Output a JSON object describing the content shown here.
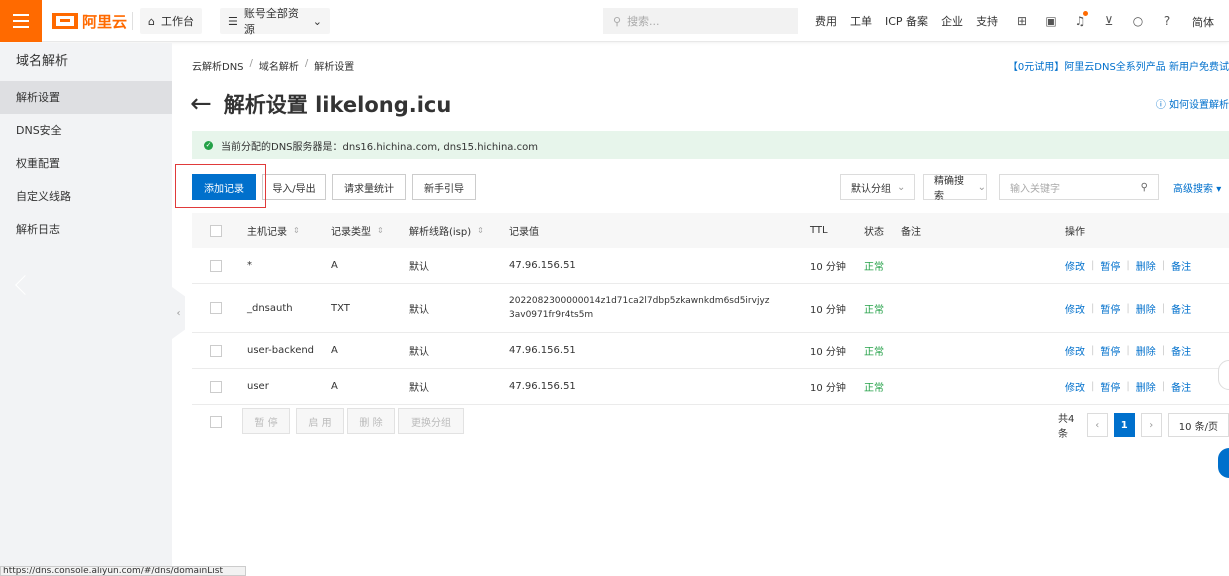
{
  "topbar": {
    "brand": "阿里云",
    "workbench": "工作台",
    "resources": "账号全部资源",
    "search_placeholder": "搜索...",
    "links": [
      "费用",
      "工单",
      "ICP 备案",
      "企业",
      "支持"
    ],
    "lang": "简体"
  },
  "sidebar": {
    "title": "域名解析",
    "items": [
      {
        "label": "解析设置",
        "active": true
      },
      {
        "label": "DNS安全",
        "active": false
      },
      {
        "label": "权重配置",
        "active": false
      },
      {
        "label": "自定义线路",
        "active": false
      },
      {
        "label": "解析日志",
        "active": false
      }
    ]
  },
  "breadcrumb": [
    "云解析DNS",
    "域名解析",
    "解析设置"
  ],
  "promo": "【0元试用】阿里云DNS全系列产品 新用户免费试",
  "page_title": "解析设置 likelong.icu",
  "help_link": "如何设置解析",
  "dns_banner": "当前分配的DNS服务器是：dns16.hichina.com, dns15.hichina.com",
  "toolbar": {
    "add": "添加记录",
    "import_export": "导入/导出",
    "stats": "请求量统计",
    "guide": "新手引导",
    "group_select": "默认分组",
    "search_mode": "精确搜索",
    "keyword_placeholder": "输入关键字",
    "advanced": "高级搜索"
  },
  "table": {
    "headers": [
      "主机记录",
      "记录类型",
      "解析线路(isp)",
      "记录值",
      "TTL",
      "状态",
      "备注",
      "操作"
    ],
    "rows": [
      {
        "host": "*",
        "type": "A",
        "line": "默认",
        "value": "47.96.156.51",
        "value2": "",
        "ttl": "10 分钟",
        "status": "正常"
      },
      {
        "host": "_dnsauth",
        "type": "TXT",
        "line": "默认",
        "value": "2022082300000014z1d71ca2l7dbp5zkawnkdm6sd5irvjyz",
        "value2": "3av0971fr9r4ts5m",
        "ttl": "10 分钟",
        "status": "正常"
      },
      {
        "host": "user-backend",
        "type": "A",
        "line": "默认",
        "value": "47.96.156.51",
        "value2": "",
        "ttl": "10 分钟",
        "status": "正常"
      },
      {
        "host": "user",
        "type": "A",
        "line": "默认",
        "value": "47.96.156.51",
        "value2": "",
        "ttl": "10 分钟",
        "status": "正常"
      }
    ],
    "ops": [
      "修改",
      "暂停",
      "删除",
      "备注"
    ]
  },
  "bulk": {
    "pause": "暂 停",
    "enable": "启 用",
    "delete": "删 除",
    "change_group": "更换分组"
  },
  "pager": {
    "total": "共4条",
    "current": "1",
    "page_size": "10 条/页"
  },
  "statusbar": "https://dns.console.aliyun.com/#/dns/domainList",
  "colors": {
    "brand": "#ff6a00",
    "primary": "#0070cc",
    "success": "#24a148"
  }
}
